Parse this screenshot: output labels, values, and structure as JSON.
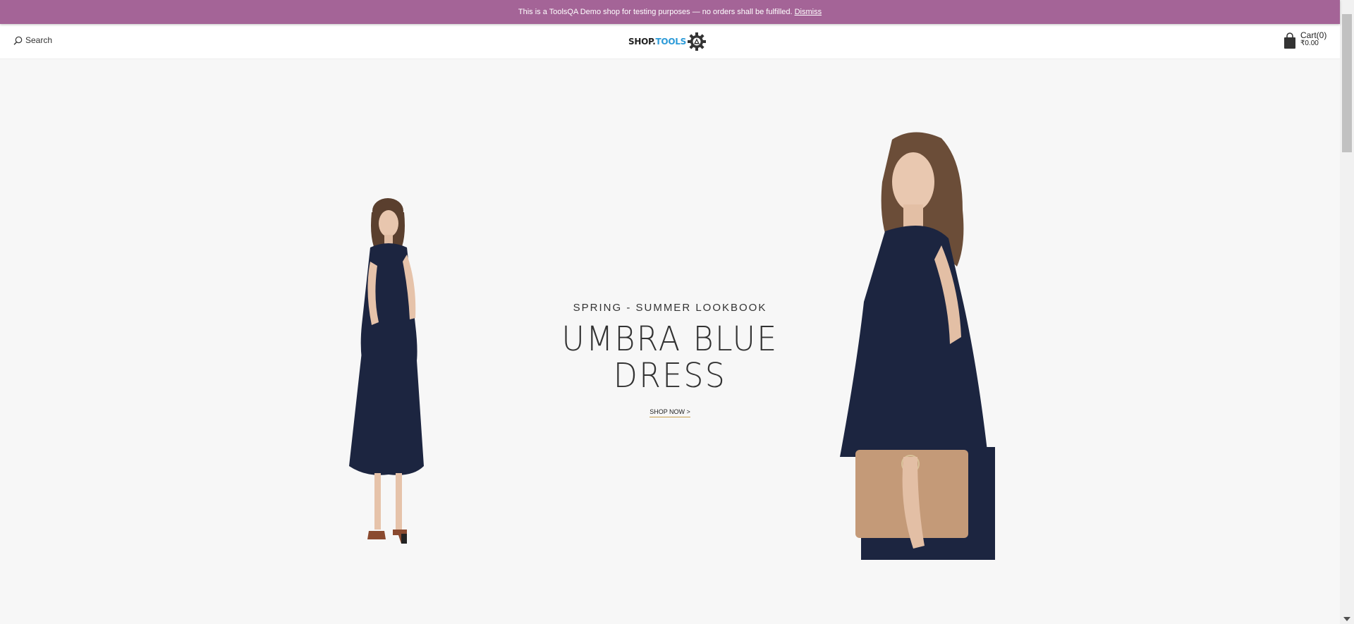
{
  "banner": {
    "message": "This is a ToolsQA Demo shop for testing purposes — no orders shall be fulfilled.",
    "dismiss_label": "Dismiss",
    "background_color": "#a46497"
  },
  "header": {
    "search_label": "Search",
    "search_icon": "search-icon",
    "logo": {
      "part1": "SHOP.",
      "part2": "TOOLS",
      "icon": "gear-icon"
    },
    "cart": {
      "label": "Cart(0)",
      "amount": "₹0.00",
      "icon": "shopping-bag-icon"
    }
  },
  "hero": {
    "kicker": "SPRING - SUMMER LOOKBOOK",
    "headline_line1": "UMBRA BLUE",
    "headline_line2": "DRESS",
    "cta": "SHOP NOW >",
    "accent_color": "#c99e4a",
    "dress_color": "#1c2540"
  }
}
